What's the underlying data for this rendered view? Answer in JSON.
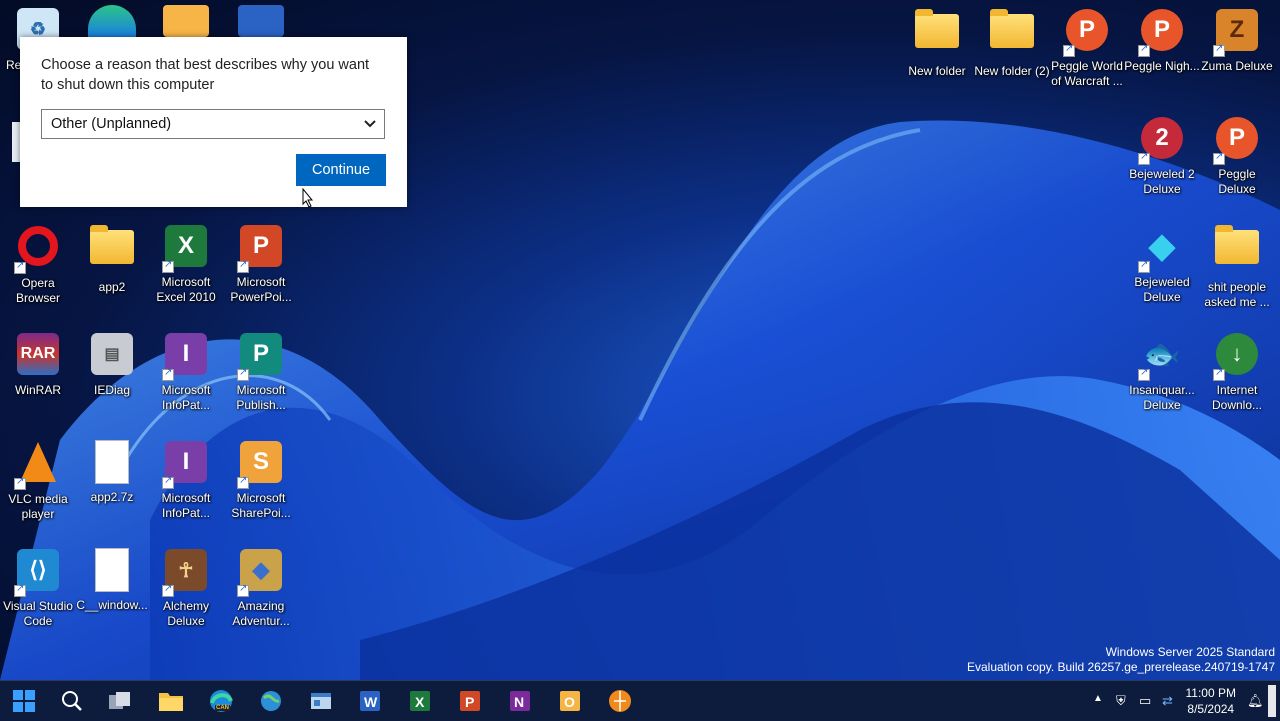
{
  "dialog": {
    "question": "Choose a reason that best describes why you want to shut down this computer",
    "selected_reason": "Other (Unplanned)",
    "continue_label": "Continue"
  },
  "desktop": {
    "left_icons": [
      {
        "label": "Re",
        "icon": "recycle-bin-icon"
      },
      {
        "label": "Opera Browser",
        "icon": "opera-icon"
      },
      {
        "label": "app2",
        "icon": "folder-icon"
      },
      {
        "label": "Microsoft Excel 2010",
        "icon": "excel-icon"
      },
      {
        "label": "Microsoft PowerPoi...",
        "icon": "powerpoint-icon"
      },
      {
        "label": "WinRAR",
        "icon": "winrar-icon"
      },
      {
        "label": "IEDiag",
        "icon": "iediag-icon"
      },
      {
        "label": "Microsoft InfoPat...",
        "icon": "infopath-icon"
      },
      {
        "label": "Microsoft Publish...",
        "icon": "publisher-icon"
      },
      {
        "label": "VLC media player",
        "icon": "vlc-icon"
      },
      {
        "label": "app2.7z",
        "icon": "file-icon"
      },
      {
        "label": "Microsoft InfoPat...",
        "icon": "infopath-icon"
      },
      {
        "label": "Microsoft SharePoi...",
        "icon": "sharepoint-icon"
      },
      {
        "label": "Visual Studio Code",
        "icon": "vscode-icon"
      },
      {
        "label": "C__window...",
        "icon": "file-icon"
      },
      {
        "label": "Alchemy Deluxe",
        "icon": "alchemy-icon"
      },
      {
        "label": "Amazing Adventur...",
        "icon": "amazing-adventures-icon"
      }
    ],
    "right_icons": [
      {
        "label": "New folder",
        "icon": "folder-icon"
      },
      {
        "label": "New folder (2)",
        "icon": "folder-icon"
      },
      {
        "label": "Peggle World of Warcraft ...",
        "icon": "peggle-icon"
      },
      {
        "label": "Peggle Nigh...",
        "icon": "peggle-icon"
      },
      {
        "label": "Zuma Deluxe",
        "icon": "zuma-icon"
      },
      {
        "label": "Bejeweled 2 Deluxe",
        "icon": "bejeweled2-icon"
      },
      {
        "label": "Peggle Deluxe",
        "icon": "peggle-icon"
      },
      {
        "label": "Bejeweled Deluxe",
        "icon": "bejeweled-icon"
      },
      {
        "label": "shit people asked me ...",
        "icon": "folder-icon"
      },
      {
        "label": "Insaniquar... Deluxe",
        "icon": "insaniquarium-icon"
      },
      {
        "label": "Internet Downlo...",
        "icon": "idm-icon"
      }
    ]
  },
  "watermark": {
    "line1": "Windows Server 2025 Standard",
    "line2": "Evaluation copy. Build 26257.ge_prerelease.240719-1747"
  },
  "taskbar": {
    "time": "11:00 PM",
    "date": "8/5/2024",
    "edge_badge": "CAN"
  }
}
